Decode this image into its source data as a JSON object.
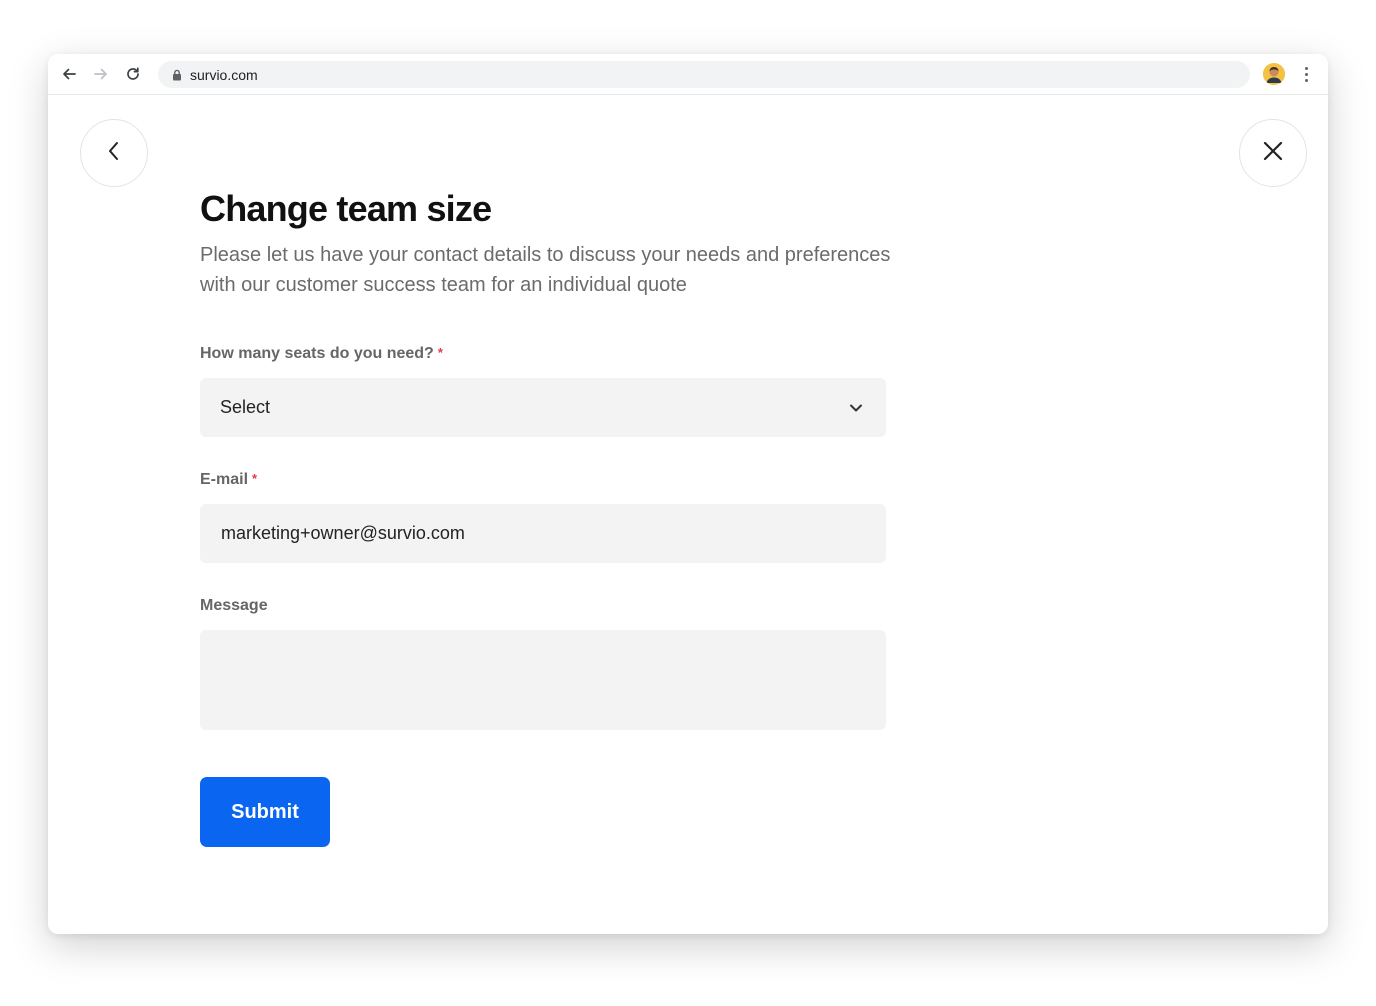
{
  "browser": {
    "url": "survio.com",
    "icons": {
      "back": "arrow-left-icon",
      "forward": "arrow-right-icon",
      "reload": "reload-icon",
      "lock": "lock-icon",
      "menu": "more-vertical-icon"
    }
  },
  "page": {
    "title": "Change team size",
    "subtitle": "Please let us have your contact details to discuss your needs and preferences with our customer success team for an individual quote",
    "seats": {
      "label": "How many seats do you need?",
      "required_mark": "*",
      "selected": "Select"
    },
    "email": {
      "label": "E-mail",
      "required_mark": "*",
      "value": "marketing+owner@survio.com"
    },
    "message": {
      "label": "Message",
      "value": ""
    },
    "submit_label": "Submit"
  },
  "colors": {
    "accent": "#0a66f0",
    "required": "#e23b4b",
    "field_bg": "#f3f3f3"
  }
}
